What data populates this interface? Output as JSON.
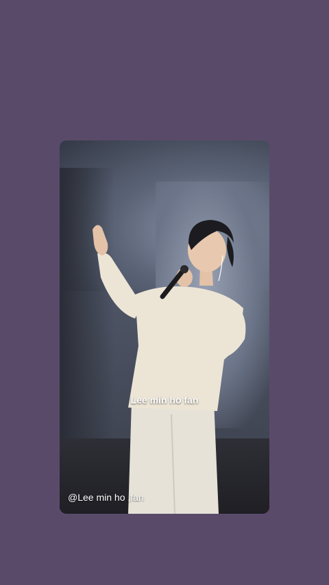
{
  "story": {
    "caption_center": "Lee min ho fan",
    "caption_bottom": "@Lee min ho ,fan"
  },
  "colors": {
    "background": "#5a4a6a"
  }
}
